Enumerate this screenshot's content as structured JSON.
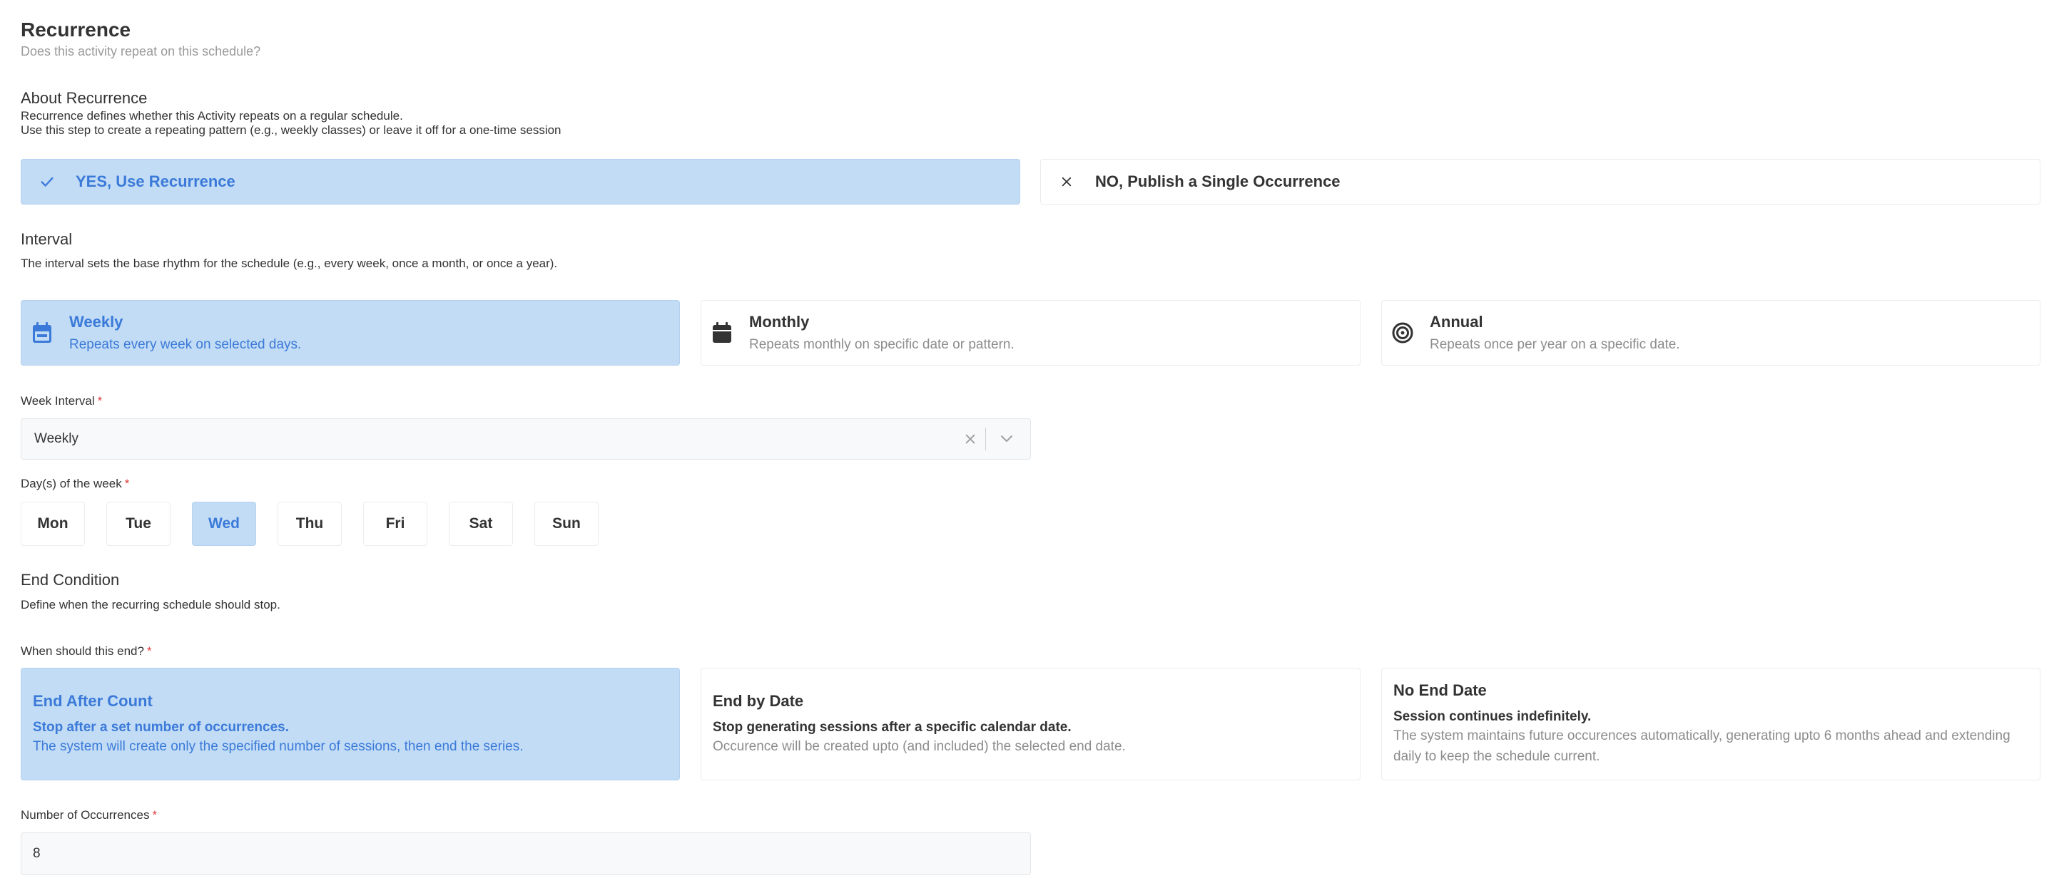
{
  "header": {
    "title": "Recurrence",
    "subtitle": "Does this activity repeat on this schedule?"
  },
  "about": {
    "title": "About Recurrence",
    "line1": "Recurrence defines whether this Activity repeats on a regular schedule.",
    "line2": "Use this step to create a repeating pattern (e.g., weekly classes) or leave it off for a one-time session"
  },
  "recurrence_toggle": {
    "yes_label": "YES, Use Recurrence",
    "no_label": "NO, Publish a Single Occurrence",
    "selected": "yes"
  },
  "interval": {
    "title": "Interval",
    "description": "The interval sets the base rhythm for the schedule (e.g., every week, once a month, or once a year).",
    "options": [
      {
        "title": "Weekly",
        "description": "Repeats every week on selected days.",
        "icon": "calendar-icon",
        "selected": true
      },
      {
        "title": "Monthly",
        "description": "Repeats monthly on specific date or pattern.",
        "icon": "calendar-icon",
        "selected": false
      },
      {
        "title": "Annual",
        "description": "Repeats once per year on a specific date.",
        "icon": "target-icon",
        "selected": false
      }
    ]
  },
  "week_interval": {
    "label": "Week Interval",
    "required_mark": "*",
    "value": "Weekly"
  },
  "days": {
    "label": "Day(s) of the week",
    "required_mark": "*",
    "items": [
      {
        "label": "Mon",
        "selected": false
      },
      {
        "label": "Tue",
        "selected": false
      },
      {
        "label": "Wed",
        "selected": true
      },
      {
        "label": "Thu",
        "selected": false
      },
      {
        "label": "Fri",
        "selected": false
      },
      {
        "label": "Sat",
        "selected": false
      },
      {
        "label": "Sun",
        "selected": false
      }
    ]
  },
  "end_condition": {
    "title": "End Condition",
    "description": "Define when the recurring schedule should stop.",
    "question": "When should this end?",
    "required_mark": "*",
    "options": [
      {
        "title": "End After Count",
        "bold": "Stop after a set number of occurrences.",
        "description": "The system will create only the specified number of sessions, then end the series.",
        "selected": true
      },
      {
        "title": "End by Date",
        "bold": "Stop generating sessions after a specific calendar date.",
        "description": "Occurence will be created upto (and included) the selected end date.",
        "selected": false
      },
      {
        "title": "No End Date",
        "bold": "Session continues indefinitely.",
        "description": "The system maintains future occurences automatically, generating upto 6 months ahead and extending daily to keep the schedule current.",
        "selected": false
      }
    ]
  },
  "occurrences": {
    "label": "Number of Occurrences",
    "required_mark": "*",
    "value": "8"
  },
  "colors": {
    "accent": "#3b7ad8",
    "selected_bg": "#c2dcf6",
    "required": "#e03b3b"
  }
}
